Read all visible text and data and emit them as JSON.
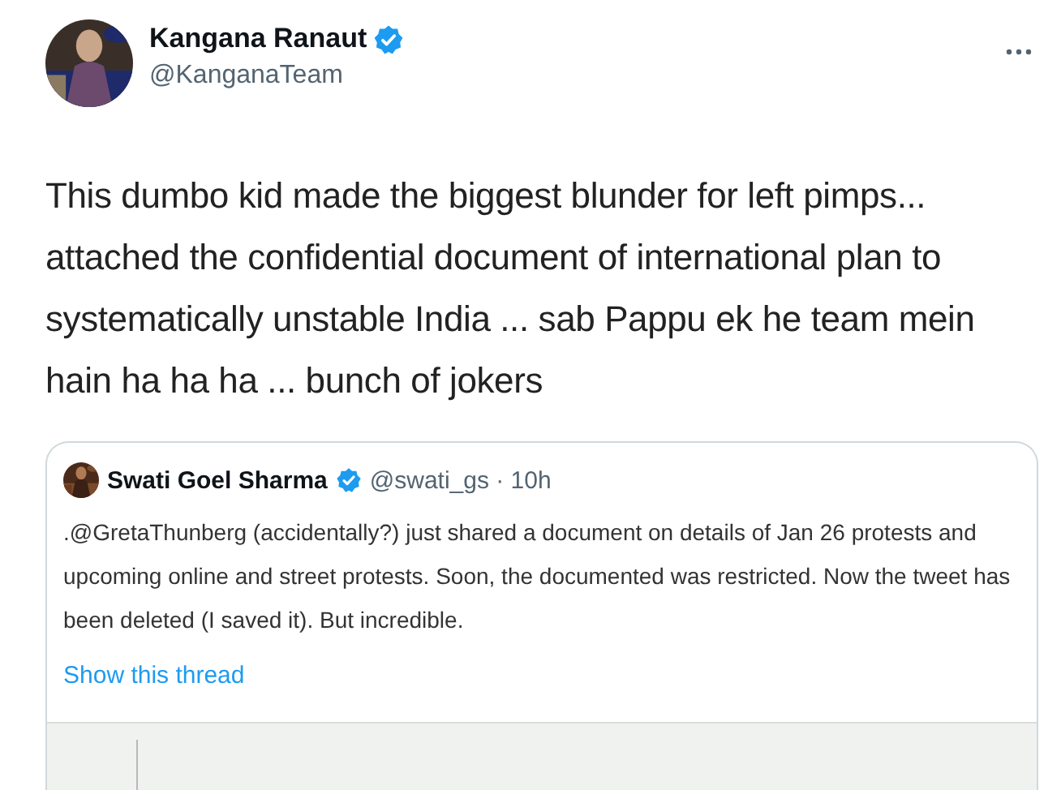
{
  "tweet": {
    "author": {
      "name": "Kangana Ranaut",
      "handle": "@KanganaTeam",
      "verified": true
    },
    "text": "This dumbo kid made the biggest blunder for left pimps... attached the confidential document of international plan to systematically unstable India ... sab Pappu ek he team mein hain ha ha ha ... bunch of jokers",
    "quoted": {
      "author": {
        "name": "Swati Goel Sharma",
        "verified": true,
        "meta": "@swati_gs · 10h"
      },
      "text": ".@GretaThunberg (accidentally?) just shared a document on details of Jan 26 protests and upcoming online and street protests. Soon, the documented was restricted. Now the tweet has been deleted (I saved it). But incredible.",
      "link": "Show this thread",
      "media": {
        "kind": "document"
      }
    }
  }
}
